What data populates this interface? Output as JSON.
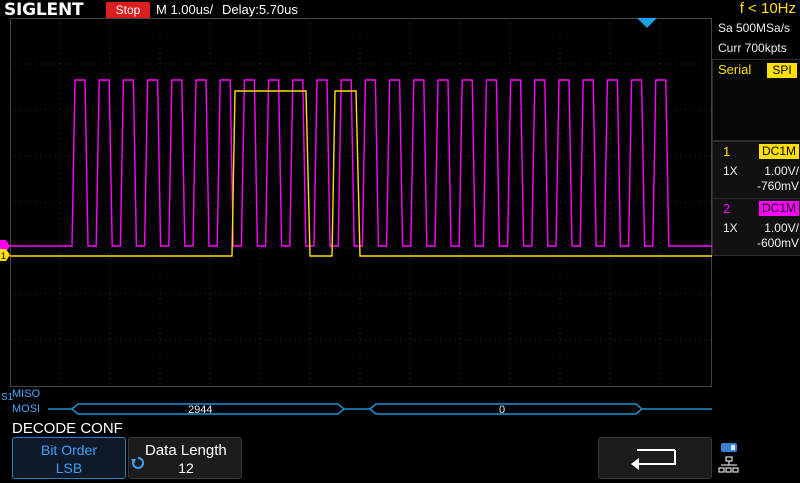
{
  "header": {
    "brand": "SIGLENT",
    "run_state": "Stop",
    "timebase": "M 1.00us/",
    "delay": "Delay:5.70us",
    "frequency": "f < 10Hz"
  },
  "acquisition": {
    "sample_rate": "Sa 500MSa/s",
    "memory_depth": "Curr 700kpts"
  },
  "trigger": {
    "type_label": "Serial",
    "protocol_badge": "SPI"
  },
  "channels": [
    {
      "number": "1",
      "coupling": "DC1M",
      "probe": "1X",
      "scale": "1.00V/",
      "offset": "-760mV",
      "color": "#ffe000"
    },
    {
      "number": "2",
      "coupling": "DC1M",
      "probe": "1X",
      "scale": "1.00V/",
      "offset": "-600mV",
      "color": "#ff00ff"
    }
  ],
  "decode": {
    "bus_id": "S1",
    "miso_label": "MISO",
    "mosi_label": "MOSI",
    "mosi_values": [
      "2944",
      "0"
    ]
  },
  "markers": {
    "ch1_marker": "1",
    "ch2_marker": "2"
  },
  "menu": {
    "title": "DECODE CONF",
    "bit_order_label": "Bit Order",
    "bit_order_value": "LSB",
    "data_length_label": "Data Length",
    "data_length_value": "12",
    "back_icon": "return-arrow-icon"
  },
  "colors": {
    "ch1": "#ffe000",
    "ch2": "#ff00ff",
    "decode": "#1e90d0",
    "stop": "#d81e1e"
  }
}
